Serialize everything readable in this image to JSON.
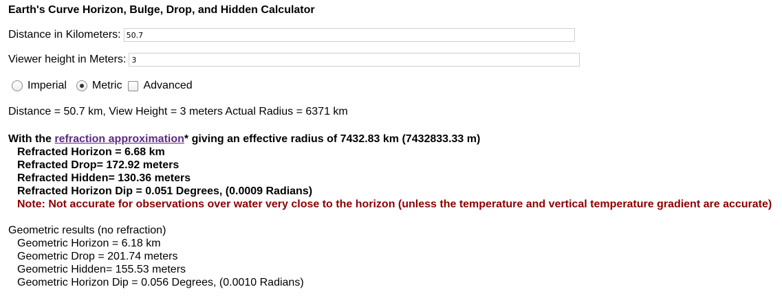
{
  "title": "Earth's Curve Horizon, Bulge, Drop, and Hidden Calculator",
  "inputs": {
    "distance_label": "Distance in Kilometers:",
    "distance_value": "50.7",
    "height_label": "Viewer height in Meters:",
    "height_value": "3"
  },
  "units": {
    "imperial_label": "Imperial",
    "metric_label": "Metric",
    "advanced_label": "Advanced",
    "selected": "Metric",
    "advanced_checked": false
  },
  "summary": "Distance = 50.7 km, View Height = 3 meters Actual Radius = 6371 km",
  "refraction": {
    "intro_prefix": "With the ",
    "link_text": "refraction approximation",
    "intro_suffix": "* giving an effective radius of 7432.83 km (7432833.33 m)",
    "horizon": "Refracted Horizon = 6.68 km",
    "drop": "Refracted Drop= 172.92 meters",
    "hidden": "Refracted Hidden= 130.36 meters",
    "dip": "Refracted Horizon Dip = 0.051 Degrees, (0.0009 Radians)",
    "note": "Note: Not accurate for observations over water very close to the horizon (unless the temperature and vertical temperature gradient are accurate)"
  },
  "geometric": {
    "heading": "Geometric results (no refraction)",
    "horizon": "Geometric Horizon = 6.18 km",
    "drop": "Geometric Drop = 201.74 meters",
    "hidden": "Geometric Hidden= 155.53 meters",
    "dip": "Geometric Horizon Dip = 0.056 Degrees, (0.0010 Radians)"
  },
  "colors": {
    "link": "#5b2a86",
    "note": "#8b0000"
  }
}
